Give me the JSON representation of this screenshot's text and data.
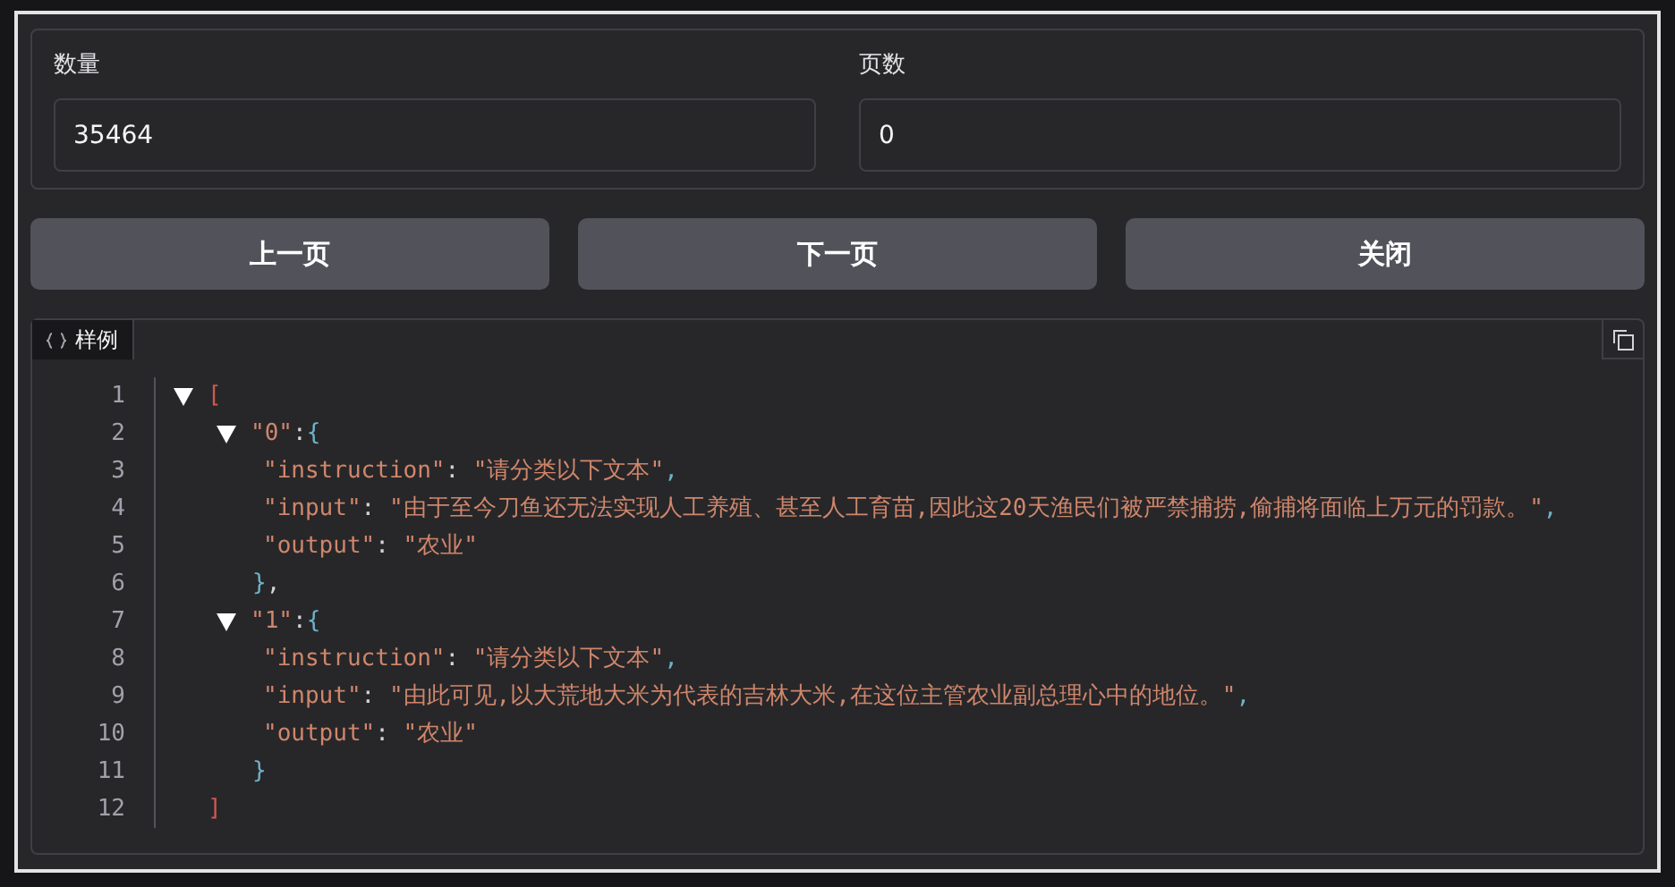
{
  "fields": [
    {
      "label": "数量",
      "value": "35464"
    },
    {
      "label": "页数",
      "value": "0"
    }
  ],
  "buttons": [
    "上一页",
    "下一页",
    "关闭"
  ],
  "sample": {
    "tab": {
      "label": "样例",
      "selected": true
    },
    "line_numbers": [
      "1",
      "2",
      "3",
      "4",
      "5",
      "6",
      "7",
      "8",
      "9",
      "10",
      "11",
      "12"
    ],
    "tree": {
      "expanded": true,
      "open": "[",
      "close": "]",
      "children": [
        {
          "key": "\"0\"",
          "colon": ":",
          "expanded": true,
          "open": "{",
          "close": "}",
          "trailer": ",",
          "fields": [
            {
              "key": "\"instruction\"",
              "colon": ": ",
              "value": "\"请分类以下文本\"",
              "comma": ","
            },
            {
              "key": "\"input\"",
              "colon": ": ",
              "value": "\"由于至今刀鱼还无法实现人工养殖、甚至人工育苗,因此这20天渔民们被严禁捕捞,偷捕将面临上万元的罚款。\"",
              "comma": ","
            },
            {
              "key": "\"output\"",
              "colon": ": ",
              "value": "\"农业\""
            }
          ]
        },
        {
          "key": "\"1\"",
          "colon": ":",
          "expanded": true,
          "open": "{",
          "close": "}",
          "fields": [
            {
              "key": "\"instruction\"",
              "colon": ": ",
              "value": "\"请分类以下文本\"",
              "comma": ","
            },
            {
              "key": "\"input\"",
              "colon": ": ",
              "value": "\"由此可见,以大荒地大米为代表的吉林大米,在这位主管农业副总理心中的地位。\"",
              "comma": ","
            },
            {
              "key": "\"output\"",
              "colon": ": ",
              "value": "\"农业\""
            }
          ]
        }
      ]
    }
  }
}
